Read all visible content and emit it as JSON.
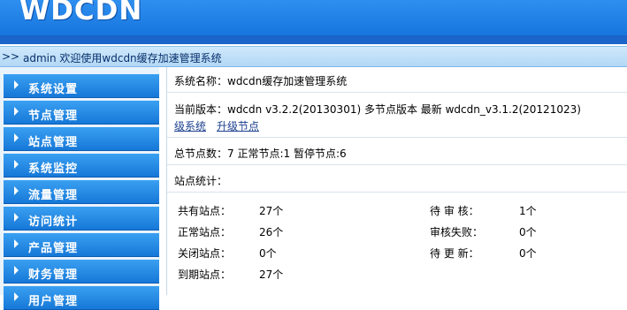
{
  "header": {
    "logo": "WDCDN"
  },
  "welcome": {
    "arrows": ">>",
    "message": "admin 欢迎使用wdcdn缓存加速管理系统"
  },
  "sidebar": {
    "items": [
      {
        "label": "系统设置"
      },
      {
        "label": "节点管理"
      },
      {
        "label": "站点管理"
      },
      {
        "label": "系统监控"
      },
      {
        "label": "流量管理"
      },
      {
        "label": "访问统计"
      },
      {
        "label": "产品管理"
      },
      {
        "label": "财务管理"
      },
      {
        "label": "用户管理"
      }
    ]
  },
  "info": {
    "system_name": "系统名称：wdcdn缓存加速管理系统",
    "version_text": "当前版本：wdcdn v3.2.2(20130301) 多节点版本 最新 wdcdn_v3.1.2(20121023)",
    "upgrade_system": "级系统",
    "upgrade_node": "升级节点",
    "node_counts": "总节点数：7  正常节点:1  暂停节点:6",
    "site_stats_title": "站点统计："
  },
  "stats": {
    "left": [
      {
        "label": "共有站点：",
        "value": "27个"
      },
      {
        "label": "正常站点：",
        "value": "26个"
      },
      {
        "label": "关闭站点：",
        "value": "0个"
      },
      {
        "label": "到期站点：",
        "value": "27个"
      }
    ],
    "right": [
      {
        "label": "待 审 核：",
        "value": "1个"
      },
      {
        "label": "审核失败：",
        "value": "0个"
      },
      {
        "label": "待 更 新：",
        "value": "0个"
      }
    ]
  }
}
